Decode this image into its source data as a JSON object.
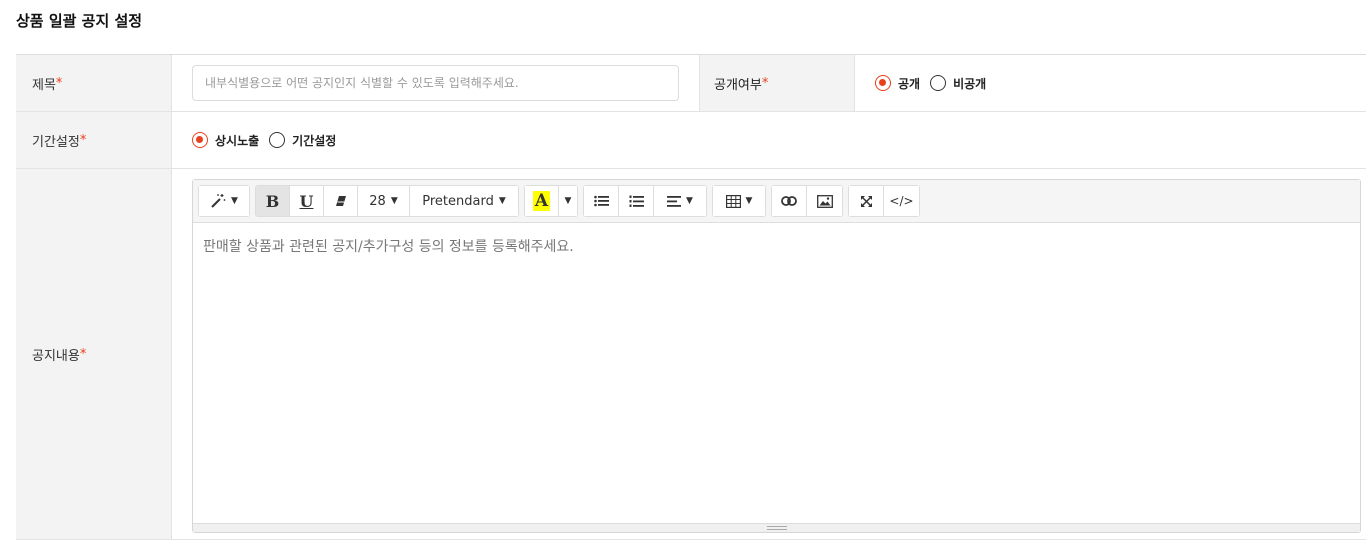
{
  "page": {
    "title": "상품 일괄 공지 설정"
  },
  "form": {
    "title_field": {
      "label": "제목",
      "required": "*",
      "placeholder": "내부식별용으로 어떤 공지인지 식별할 수 있도록 입력해주세요.",
      "value": ""
    },
    "visibility": {
      "label": "공개여부",
      "required": "*",
      "options": [
        "공개",
        "비공개"
      ],
      "selected": "공개"
    },
    "period": {
      "label": "기간설정",
      "required": "*",
      "options": [
        "상시노출",
        "기간설정"
      ],
      "selected": "상시노출"
    },
    "content": {
      "label": "공지내용",
      "required": "*",
      "placeholder": "판매할 상품과 관련된 공지/추가구성 등의 정보를 등록해주세요."
    }
  },
  "toolbar": {
    "bold": "B",
    "underline": "U",
    "font_size": "28",
    "font_family": "Pretendard",
    "color_letter": "A",
    "code_view": "</>",
    "highlight_color": "#ffff00"
  },
  "colors": {
    "accent": "#e8401c",
    "label_bg": "#f3f3f3"
  }
}
